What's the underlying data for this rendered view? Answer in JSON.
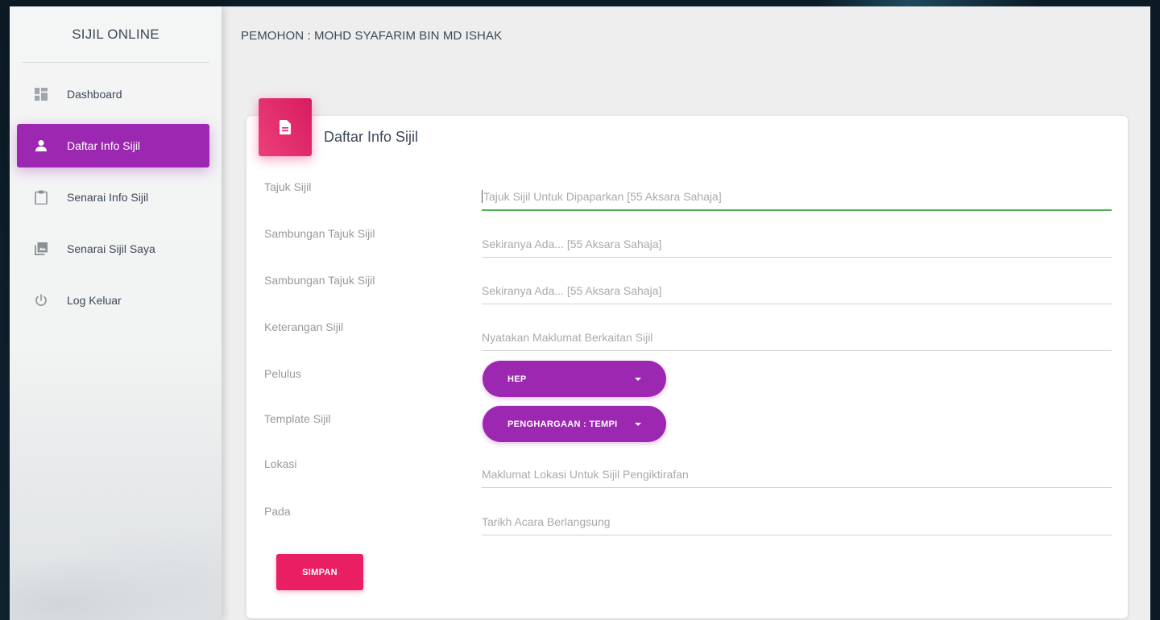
{
  "sidebar": {
    "brand": "SIJIL ONLINE",
    "items": [
      {
        "label": "Dashboard",
        "icon": "dashboard-icon"
      },
      {
        "label": "Daftar Info Sijil",
        "icon": "person-icon",
        "active": true
      },
      {
        "label": "Senarai Info Sijil",
        "icon": "clipboard-icon"
      },
      {
        "label": "Senarai Sijil Saya",
        "icon": "photo-library-icon"
      },
      {
        "label": "Log Keluar",
        "icon": "power-icon"
      }
    ]
  },
  "header": {
    "applicant": "PEMOHON : MOHD SYAFARIM BIN MD ISHAK"
  },
  "form": {
    "title": "Daftar Info Sijil",
    "fields": {
      "tajuk": {
        "label": "Tajuk Sijil",
        "placeholder": "Tajuk Sijil Untuk Dipaparkan [55 Aksara Sahaja]"
      },
      "sambungan1": {
        "label": "Sambungan Tajuk Sijil",
        "placeholder": "Sekiranya Ada... [55 Aksara Sahaja]"
      },
      "sambungan2": {
        "label": "Sambungan Tajuk Sijil",
        "placeholder": "Sekiranya Ada... [55 Aksara Sahaja]"
      },
      "keterangan": {
        "label": "Keterangan Sijil",
        "placeholder": "Nyatakan Maklumat Berkaitan Sijil"
      },
      "pelulus": {
        "label": "Pelulus",
        "value": "HEP"
      },
      "template": {
        "label": "Template Sijil",
        "value": "PENGHARGAAN : TEMPI"
      },
      "lokasi": {
        "label": "Lokasi",
        "placeholder": "Maklumat Lokasi Untuk Sijil Pengiktirafan"
      },
      "pada": {
        "label": "Pada",
        "placeholder": "Tarikh Acara Berlangsung"
      }
    },
    "save_label": "SIMPAN"
  },
  "colors": {
    "primary": "#9c27b0",
    "accent": "#e91e63",
    "focus": "#4caf50"
  }
}
